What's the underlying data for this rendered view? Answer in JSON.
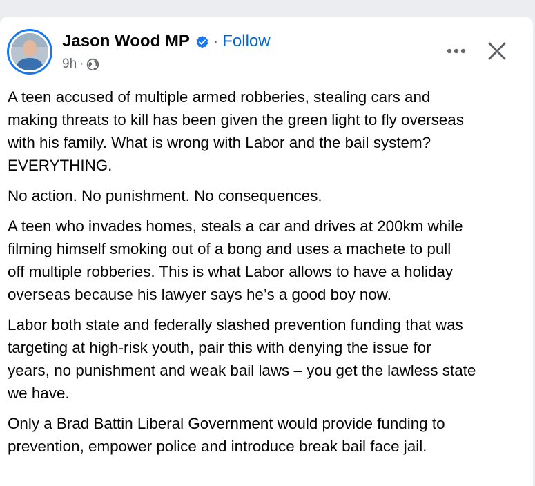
{
  "post": {
    "author": "Jason Wood MP",
    "follow_label": "Follow",
    "separator": "·",
    "time": "9h",
    "meta_separator": "·",
    "audience_icon": "globe-icon",
    "verified_icon": "verified-badge-icon",
    "more_icon": "more-options-icon",
    "close_icon": "close-icon",
    "accent_color": "#0064d1",
    "paragraphs": [
      "A teen accused of multiple armed robberies, stealing cars and\nmaking threats to kill has been given the green light to fly overseas\nwith his family. What is wrong with Labor and the bail system?\nEVERYTHING.",
      "No action. No punishment. No consequences.",
      "A teen who invades homes, steals a car and drives at 200km while\nfilming himself smoking out of a bong and uses a machete to pull\noff multiple robberies. This is what Labor allows to have a holiday\noverseas because his lawyer says he’s a good boy now.",
      "Labor both state and federally slashed prevention funding that was\ntargeting at high-risk youth, pair this with denying the issue for\nyears, no punishment and weak bail laws – you get the lawless state\nwe have.",
      "Only a Brad Battin Liberal Government would provide funding to\nprevention, empower police and introduce break bail face jail."
    ]
  }
}
